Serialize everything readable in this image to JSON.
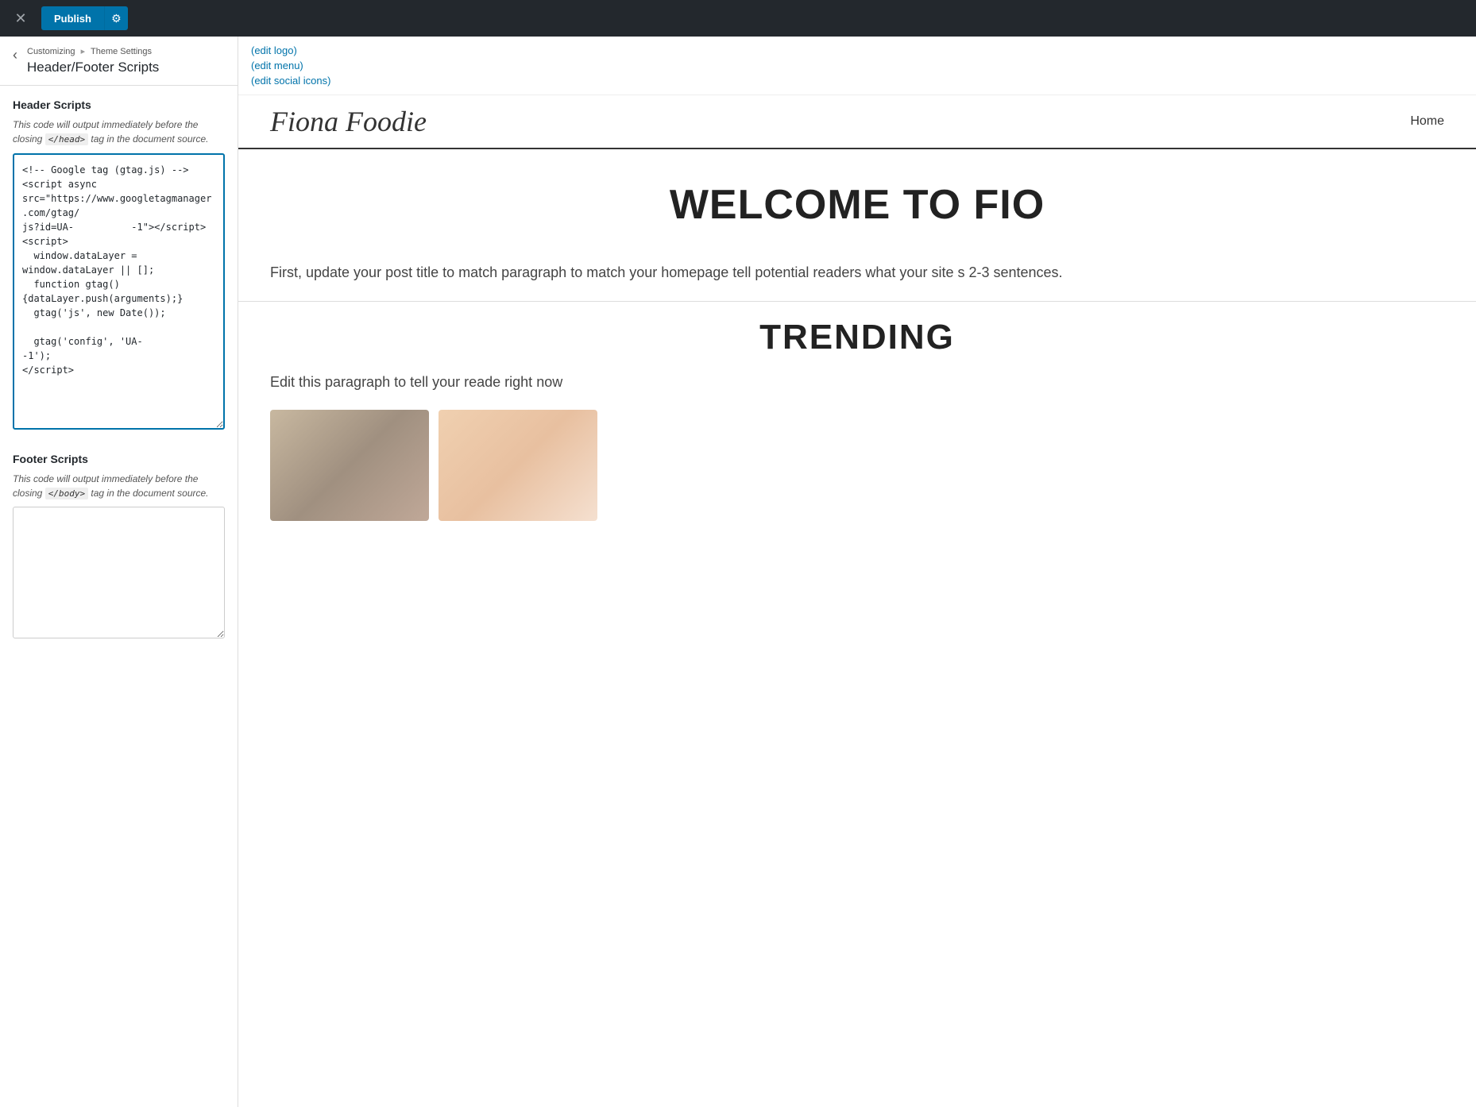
{
  "topbar": {
    "close_label": "✕",
    "publish_label": "Publish",
    "gear_label": "⚙"
  },
  "sidebar": {
    "back_label": "‹",
    "breadcrumb": {
      "part1": "Customizing",
      "separator": "▸",
      "part2": "Theme Settings"
    },
    "section_title": "Header/Footer Scripts",
    "header_scripts": {
      "label": "Header Scripts",
      "description_before": "This code will output immediately before the closing",
      "code_tag": "</head>",
      "description_after": "tag in the document source.",
      "placeholder": "",
      "value": "<!-- Google tag (gtag.js) -->\n<script async\nsrc=\"https://www.googletagmanager.com/gtag/\njs?id=UA-          -1\"></script>\n<script>\n  window.dataLayer = window.dataLayer || [];\n  function gtag(){dataLayer.push(arguments);}\n  gtag('js', new Date());\n\n  gtag('config', 'UA-          -1');\n</script>"
    },
    "footer_scripts": {
      "label": "Footer Scripts",
      "description_before": "This code will output immediately before the closing",
      "code_tag": "</body>",
      "description_after": "tag in the document source.",
      "value": ""
    }
  },
  "preview": {
    "edit_links": [
      "(edit logo)",
      "(edit menu)",
      "(edit social icons)"
    ],
    "site_name": "Fiona Foodie",
    "nav": {
      "home": "Home"
    },
    "hero_title": "WELCOME TO FIO",
    "hero_body": "First, update your post title to match\nparagraph to match your homepage\ntell potential readers what your site s\n2-3 sentences.",
    "trending_title": "TRENDING",
    "trending_body": "Edit this paragraph to tell your reade\nright now"
  }
}
